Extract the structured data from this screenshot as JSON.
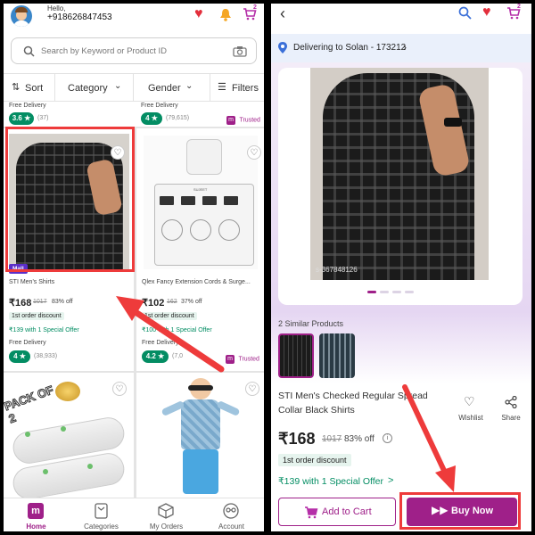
{
  "left": {
    "greeting": "Hello,",
    "phone": "+918626847453",
    "cart_count": "2",
    "search_placeholder": "Search by Keyword or Product ID",
    "filters": {
      "sort": "Sort",
      "category": "Category",
      "gender": "Gender",
      "filters": "Filters"
    },
    "top_row": {
      "left": {
        "delivery": "Free Delivery",
        "rating": "3.6 ★",
        "reviews": "(37)"
      },
      "right": {
        "delivery": "Free Delivery",
        "rating": "4 ★",
        "reviews": "(79,615)",
        "trusted": "Trusted"
      }
    },
    "products": [
      {
        "badge": "Mall",
        "name": "STI Men's Shirts",
        "price": "₹168",
        "mrp": "1017",
        "off": "83% off",
        "discount": "1st order discount",
        "offer": "₹139 with 1 Special Offer",
        "delivery": "Free Delivery",
        "rating": "4 ★",
        "reviews": "(38,933)"
      },
      {
        "name": "Qlex  Fancy Extension Cords & Surge...",
        "price": "₹102",
        "mrp": "162",
        "off": "37% off",
        "discount": "1st order discount",
        "offer": "₹100 with 1 Special Offer",
        "delivery": "Free Delivery",
        "rating": "4.2 ★",
        "reviews": "(7,0",
        "trusted": "Trusted",
        "plug_brand": "SUJEET"
      }
    ],
    "pack_text": "PACK OF 2",
    "nav": [
      {
        "label": "Home",
        "icon": "home-icon"
      },
      {
        "label": "Categories",
        "icon": "categories-icon"
      },
      {
        "label": "My Orders",
        "icon": "orders-icon"
      },
      {
        "label": "Account",
        "icon": "account-icon"
      }
    ],
    "nav_logo": "m"
  },
  "right": {
    "cart_count": "2",
    "delivery": "Delivering to Solan - 173212",
    "image_code": "s-367848126",
    "similar_title": "2 Similar Products",
    "product_title_1": "STI Men's Checked Regular Spread",
    "product_title_2": "Collar Black Shirts",
    "wishlist": "Wishlist",
    "share": "Share",
    "price": "₹168",
    "mrp": "1017",
    "off": "83% off",
    "discount": "1st order discount",
    "offer": "₹139 with 1 Special Offer",
    "offer_arrow": ">",
    "add_to_cart": "Add to Cart",
    "buy_now": "Buy Now"
  },
  "colors": {
    "accent": "#9f2089",
    "brand": "#b52fa8",
    "green": "#038d63",
    "red": "#ee3b3b",
    "annotation": "#ee3b3b"
  }
}
